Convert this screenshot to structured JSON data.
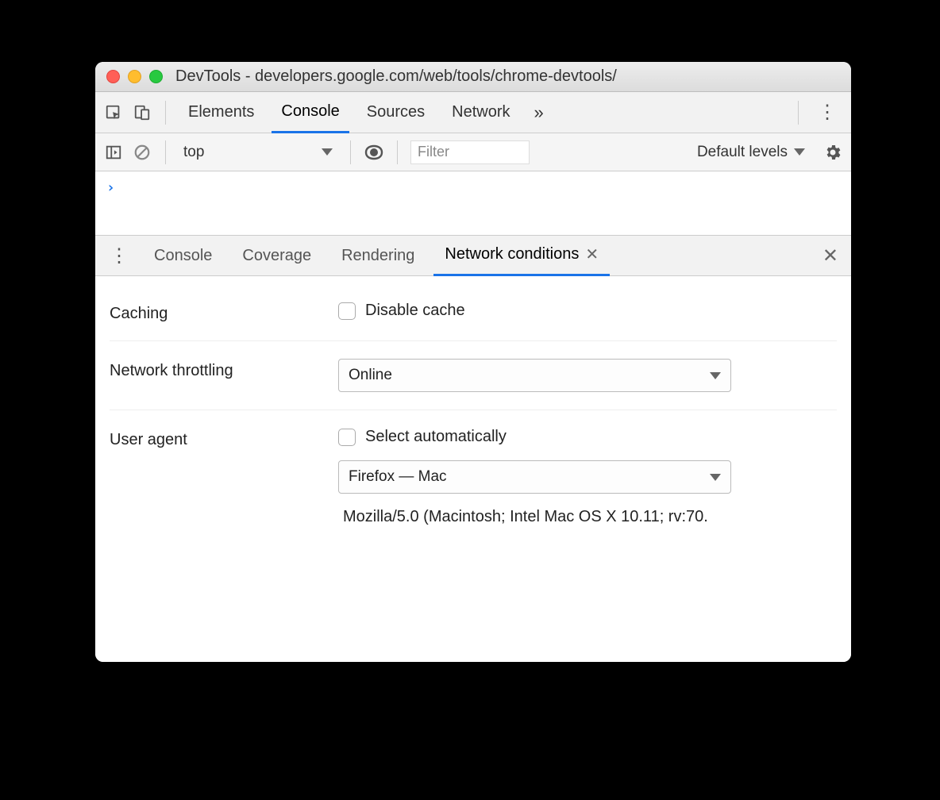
{
  "window": {
    "title": "DevTools - developers.google.com/web/tools/chrome-devtools/"
  },
  "mainTabs": {
    "items": [
      "Elements",
      "Console",
      "Sources",
      "Network"
    ],
    "active": "Console",
    "overflow": "»"
  },
  "consoleBar": {
    "context": "top",
    "filterPlaceholder": "Filter",
    "levelsLabel": "Default levels"
  },
  "consolePrompt": "›",
  "drawerTabs": {
    "items": [
      "Console",
      "Coverage",
      "Rendering",
      "Network conditions"
    ],
    "active": "Network conditions"
  },
  "networkConditions": {
    "cachingLabel": "Caching",
    "disableCacheLabel": "Disable cache",
    "throttleLabel": "Network throttling",
    "throttleValue": "Online",
    "uaLabel": "User agent",
    "uaAutoLabel": "Select automatically",
    "uaPresetValue": "Firefox — Mac",
    "uaString": "Mozilla/5.0 (Macintosh; Intel Mac OS X 10.11; rv:70."
  }
}
